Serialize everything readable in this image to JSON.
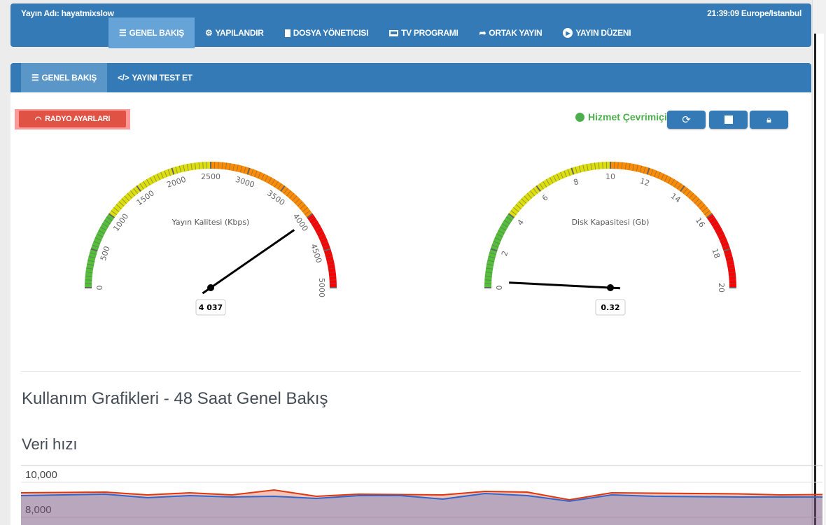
{
  "header": {
    "stream_name": "Yayın Adı: hayatmixslow",
    "clock": "21:39:09 Europe/Istanbul",
    "nav": [
      {
        "label": "GENEL BAKIŞ",
        "icon": "list-icon",
        "active": true
      },
      {
        "label": "YAPILANDIR",
        "icon": "cogs-icon"
      },
      {
        "label": "DOSYA YÖNETICISI",
        "icon": "file-icon"
      },
      {
        "label": "TV PROGRAMI",
        "icon": "monitor-icon"
      },
      {
        "label": "ORTAK YAYIN",
        "icon": "share-icon"
      },
      {
        "label": "YAYIN DÜZENI",
        "icon": "play-circle-icon"
      }
    ]
  },
  "subnav": [
    {
      "label": "GENEL BAKIŞ",
      "icon": "server-icon",
      "active": true
    },
    {
      "label": "YAYINI TEST ET",
      "icon": "code-icon"
    }
  ],
  "radio_button": {
    "label": "RADYO AYARLARI",
    "icon": "wifi-icon",
    "color": "#e05244"
  },
  "status": {
    "label": "Hizmet Çevrimiçi",
    "color": "#4cae4c"
  },
  "controls": [
    {
      "name": "restart-button",
      "icon": "refresh-icon"
    },
    {
      "name": "stop-button",
      "icon": "stop-icon"
    },
    {
      "name": "lock-button",
      "icon": "lock-icon"
    }
  ],
  "gauges": [
    {
      "title": "Yayın Kalitesi (Kbps)",
      "min": 0,
      "max": 5000,
      "value": 4037,
      "value_label": "4 037",
      "ticks": [
        "0",
        "500",
        "1000",
        "1500",
        "2000",
        "2500",
        "3000",
        "3500",
        "4000",
        "4500",
        "5000"
      ],
      "bands": [
        {
          "from": 0,
          "to": 1000,
          "color": "#55bf3b"
        },
        {
          "from": 1000,
          "to": 2500,
          "color": "#dddf0d"
        },
        {
          "from": 2500,
          "to": 4000,
          "color": "#ff8c00"
        },
        {
          "from": 4000,
          "to": 5000,
          "color": "#ff0000"
        }
      ]
    },
    {
      "title": "Disk Kapasitesi (Gb)",
      "min": 0,
      "max": 20,
      "value": 0.32,
      "value_label": "0.32",
      "ticks": [
        "0",
        "2",
        "4",
        "6",
        "8",
        "10",
        "12",
        "14",
        "16",
        "18",
        "20"
      ],
      "bands": [
        {
          "from": 0,
          "to": 4,
          "color": "#55bf3b"
        },
        {
          "from": 4,
          "to": 10,
          "color": "#dddf0d"
        },
        {
          "from": 10,
          "to": 16,
          "color": "#ff8c00"
        },
        {
          "from": 16,
          "to": 20,
          "color": "#ff0000"
        }
      ]
    }
  ],
  "section_title": "Kullanım Grafikleri - 48 Saat Genel Bakış",
  "chart_title": "Veri hızı",
  "chart_data": {
    "type": "area",
    "title": "Veri hızı",
    "y_ticks": [
      "10,000",
      "8,000"
    ],
    "y_tick_values": [
      10000,
      8000
    ],
    "grid": true,
    "series": [
      {
        "color": "#dc3912",
        "values": [
          9400,
          9420,
          9440,
          9280,
          9400,
          9280,
          9560,
          9200,
          9320,
          9300,
          9280,
          9480,
          9440,
          9000,
          9400,
          9380,
          9360,
          9340,
          9280,
          9300
        ]
      },
      {
        "color": "#3366cc",
        "values": [
          9240,
          9280,
          9320,
          9120,
          9240,
          9160,
          9200,
          9080,
          9240,
          9240,
          9040,
          9360,
          9240,
          8920,
          9280,
          9200,
          9180,
          9160,
          9160,
          9160
        ]
      }
    ]
  }
}
